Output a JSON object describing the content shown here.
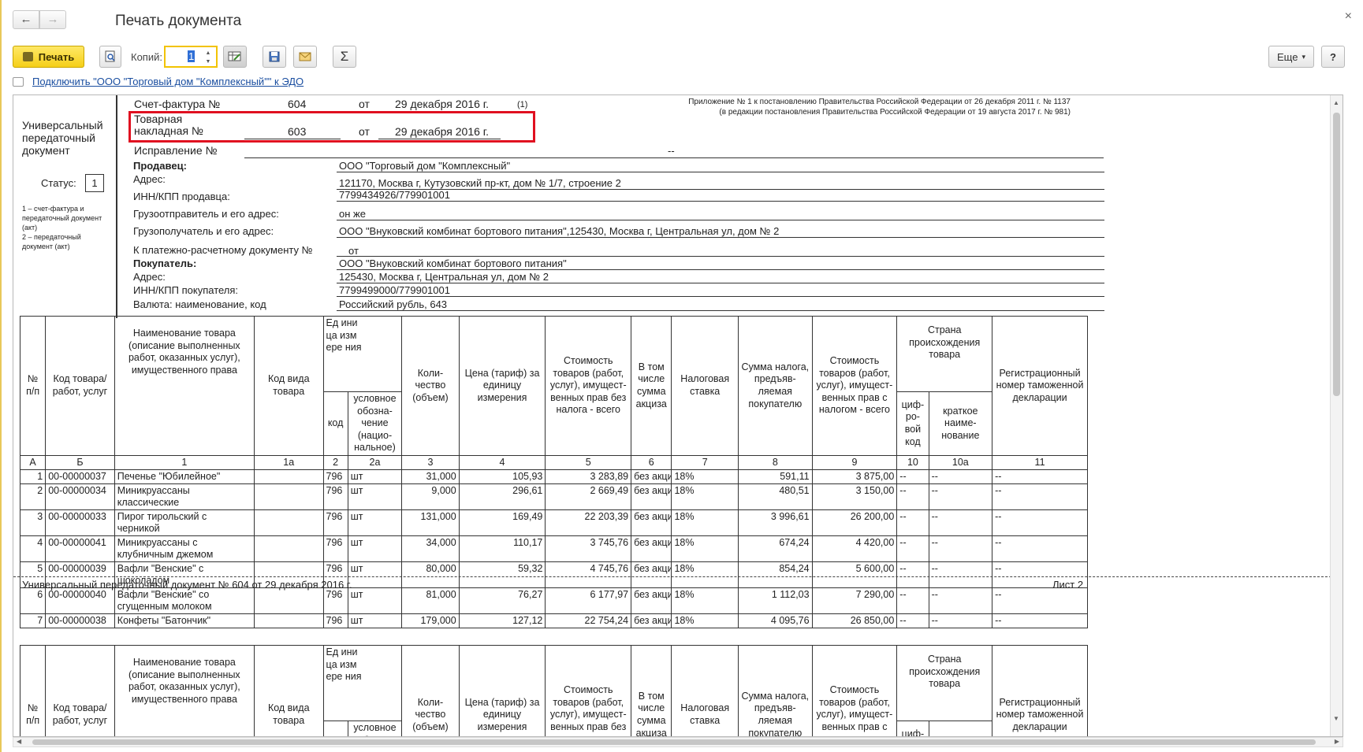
{
  "window": {
    "title": "Печать документа",
    "back": "←",
    "forward": "→",
    "close": "×"
  },
  "toolbar": {
    "print_label": "Печать",
    "copies_label": "Копий:",
    "copies_value": "1",
    "more_label": "Еще",
    "more_caret": "▾",
    "help_label": "?",
    "sum_label": "Σ"
  },
  "edo_link": "Подключить \"ООО \"Торговый дом \"Комплексный\"\" к ЭДО",
  "doc": {
    "appendix_line1": "Приложение № 1 к постановлению Правительства Российской Федерации от 26 декабря 2011 г. № 1137",
    "appendix_line2": "(в редакции постановления Правительства Российской Федерации от 19 августа 2017 г. № 981)",
    "upd_title": "Универсальный передаточный документ",
    "status_label": "Статус:",
    "status_value": "1",
    "status_note": "1 – счет-фактура и передаточный документ (акт)\n2 – передаточный документ (акт)",
    "invoice_label": "Счет-фактура №",
    "invoice_number": "604",
    "from_label": "от",
    "invoice_date": "29 декабря 2016 г.",
    "invoice_ref": "(1)",
    "waybill_label_1": "Товарная",
    "waybill_label_2": "накладная №",
    "waybill_number": "603",
    "waybill_from": "от",
    "waybill_date": "29 декабря 2016 г.",
    "correction_label": "Исправление №",
    "correction_value": "--",
    "fields": [
      {
        "label": "Продавец:",
        "value": "ООО \"Торговый дом \"Комплексный\""
      },
      {
        "label": "Адрес:",
        "value": "121170, Москва г, Кутузовский пр-кт, дом № 1/7, строение 2"
      },
      {
        "label": "ИНН/КПП продавца:",
        "value": "7799434926/779901001"
      },
      {
        "label": "Грузоотправитель и его адрес:",
        "value": "он же"
      },
      {
        "label": "Грузополучатель и его адрес:",
        "value": "ООО \"Внуковский комбинат бортового питания\",125430, Москва г, Центральная ул, дом № 2"
      },
      {
        "label": "К платежно-расчетному документу №",
        "value": "от"
      },
      {
        "label": "Покупатель:",
        "value": "ООО \"Внуковский комбинат бортового питания\""
      },
      {
        "label": "Адрес:",
        "value": "125430, Москва г, Центральная ул, дом № 2"
      },
      {
        "label": "ИНН/КПП покупателя:",
        "value": "7799499000/779901001"
      },
      {
        "label": "Валюта: наименование, код",
        "value": "Российский рубль, 643"
      }
    ],
    "headers": {
      "num": "№ п/п",
      "code": "Код товара/ работ, услуг",
      "name": "Наименование товара (описание выполненных работ, оказанных услуг), имущественного права",
      "kind": "Код вида товара",
      "unit": "Ед ини ца изм ере ния",
      "unit_code": "код",
      "unit_name": "условное обозна- чение (нацио- нальное)",
      "qty": "Коли- чество (объем)",
      "price": "Цена (тариф) за единицу измерения",
      "cost": "Стоимость товаров (работ, услуг), имущест- венных прав без налога - всего",
      "excise": "В том числе сумма акциза",
      "rate": "Налоговая ставка",
      "tax": "Сумма налога, предъяв- ляемая покупателю",
      "total": "Стоимость товаров (работ, услуг), имущест- венных прав с налогом - всего",
      "country": "Страна происхождения товара",
      "country_code": "циф- ро- вой код",
      "country_name": "краткое наиме- нование",
      "customs": "Регистрационный номер таможенной декларации"
    },
    "col_numbers": [
      "А",
      "Б",
      "1",
      "1а",
      "2",
      "2а",
      "3",
      "4",
      "5",
      "6",
      "7",
      "8",
      "9",
      "10",
      "10а",
      "11"
    ],
    "rows": [
      {
        "n": "1",
        "code": "00-00000037",
        "name": "Печенье \"Юбилейное\"",
        "unit": "796",
        "uname": "шт",
        "qty": "31,000",
        "price": "105,93",
        "cost": "3 283,89",
        "excise": "без акциза",
        "rate": "18%",
        "tax": "591,11",
        "total": "3 875,00",
        "cc": "--",
        "cn": "--",
        "cd": "--"
      },
      {
        "n": "2",
        "code": "00-00000034",
        "name": "Миникруассаны классические",
        "unit": "796",
        "uname": "шт",
        "qty": "9,000",
        "price": "296,61",
        "cost": "2 669,49",
        "excise": "без акциза",
        "rate": "18%",
        "tax": "480,51",
        "total": "3 150,00",
        "cc": "--",
        "cn": "--",
        "cd": "--"
      },
      {
        "n": "3",
        "code": "00-00000033",
        "name": "Пирог тирольский с черникой",
        "unit": "796",
        "uname": "шт",
        "qty": "131,000",
        "price": "169,49",
        "cost": "22 203,39",
        "excise": "без акциза",
        "rate": "18%",
        "tax": "3 996,61",
        "total": "26 200,00",
        "cc": "--",
        "cn": "--",
        "cd": "--"
      },
      {
        "n": "4",
        "code": "00-00000041",
        "name": "Миникруассаны с клубничным джемом",
        "unit": "796",
        "uname": "шт",
        "qty": "34,000",
        "price": "110,17",
        "cost": "3 745,76",
        "excise": "без акциза",
        "rate": "18%",
        "tax": "674,24",
        "total": "4 420,00",
        "cc": "--",
        "cn": "--",
        "cd": "--"
      },
      {
        "n": "5",
        "code": "00-00000039",
        "name": "Вафли \"Венские\" с шоколадом",
        "unit": "796",
        "uname": "шт",
        "qty": "80,000",
        "price": "59,32",
        "cost": "4 745,76",
        "excise": "без акциза",
        "rate": "18%",
        "tax": "854,24",
        "total": "5 600,00",
        "cc": "--",
        "cn": "--",
        "cd": "--"
      },
      {
        "n": "6",
        "code": "00-00000040",
        "name": "Вафли \"Венские\" со сгущенным молоком",
        "unit": "796",
        "uname": "шт",
        "qty": "81,000",
        "price": "76,27",
        "cost": "6 177,97",
        "excise": "без акциза",
        "rate": "18%",
        "tax": "1 112,03",
        "total": "7 290,00",
        "cc": "--",
        "cn": "--",
        "cd": "--"
      },
      {
        "n": "7",
        "code": "00-00000038",
        "name": "Конфеты \"Батончик\"",
        "unit": "796",
        "uname": "шт",
        "qty": "179,000",
        "price": "127,12",
        "cost": "22 754,24",
        "excise": "без акциза",
        "rate": "18%",
        "tax": "4 095,76",
        "total": "26 850,00",
        "cc": "--",
        "cn": "--",
        "cd": "--"
      }
    ],
    "page2_caption": "Универсальный передаточный документ № 604 от 29 декабря 2016 г.",
    "page2_sheet": "Лист 2"
  }
}
